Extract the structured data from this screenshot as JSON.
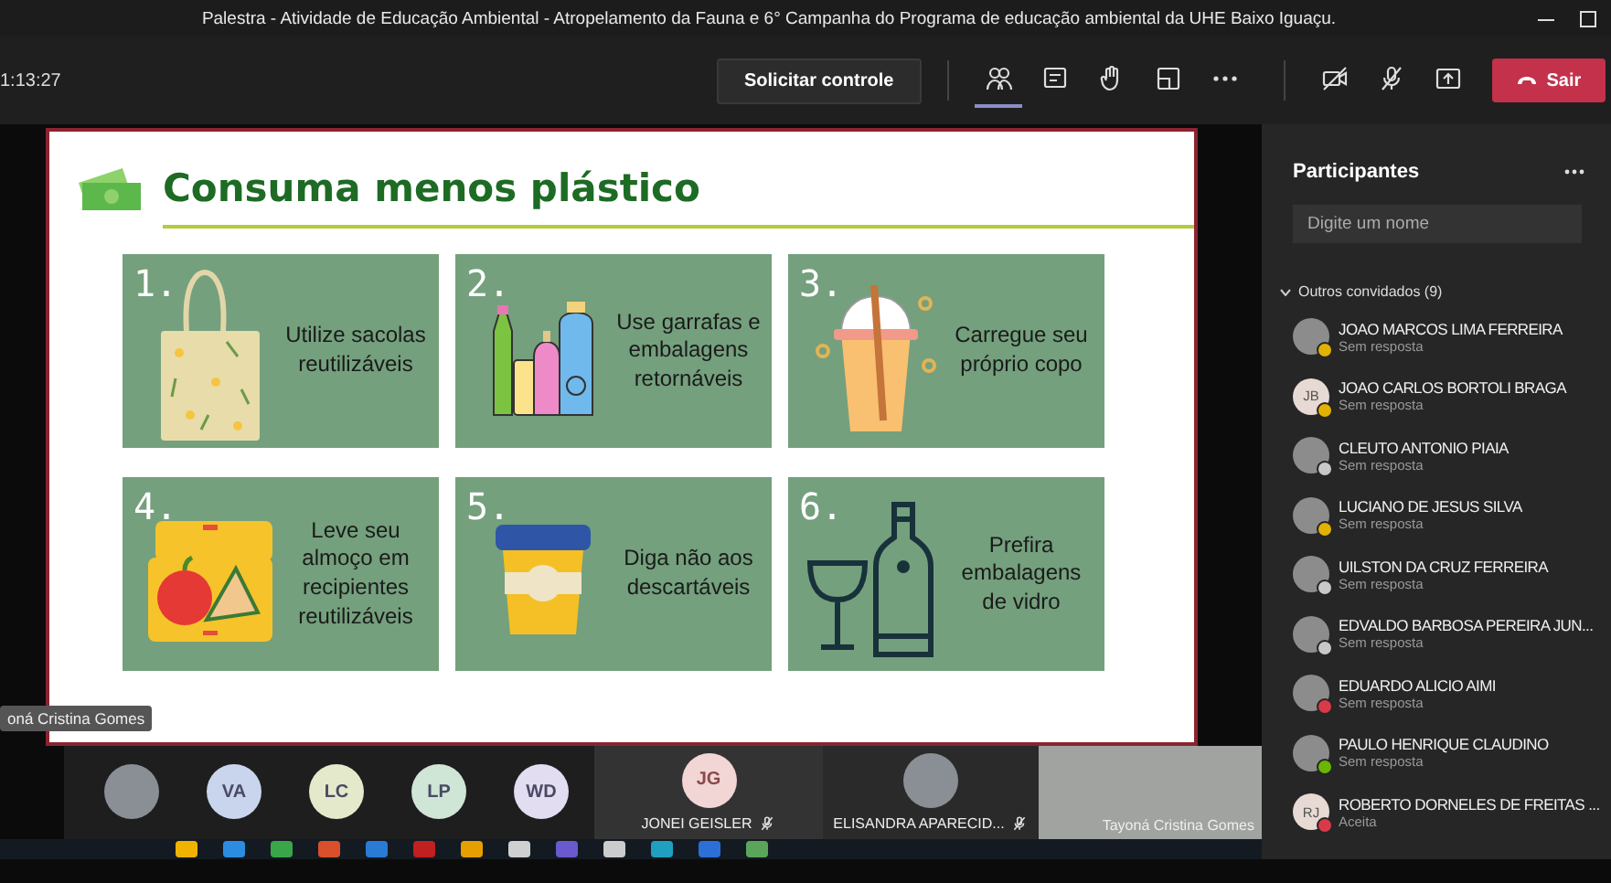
{
  "window": {
    "title": "Palestra - Atividade de Educação Ambiental - Atropelamento da Fauna e 6° Campanha do Programa de educação ambiental da UHE Baixo Iguaçu."
  },
  "toolbar": {
    "timer": "1:13:27",
    "request_control": "Solicitar controle",
    "tools": [
      {
        "kind": "people",
        "selected": true
      },
      {
        "kind": "chat",
        "selected": false
      },
      {
        "kind": "hand",
        "selected": false
      },
      {
        "kind": "rooms",
        "selected": false
      },
      {
        "kind": "more",
        "selected": false
      }
    ],
    "controls": [
      {
        "kind": "camera-off"
      },
      {
        "kind": "mic-off"
      },
      {
        "kind": "share"
      }
    ],
    "leave": "Sair"
  },
  "slide": {
    "title": "Consuma menos plástico",
    "cards": [
      {
        "number": "1.",
        "text": "Utilize sacolas reutilizáveis",
        "kind": "bag"
      },
      {
        "number": "2.",
        "text": "Use garrafas e embalagens retornáveis",
        "kind": "bottles"
      },
      {
        "number": "3.",
        "text": "Carregue seu próprio copo",
        "kind": "cup"
      },
      {
        "number": "4.",
        "text": "Leve seu almoço em recipientes reutilizáveis",
        "kind": "lunchbox"
      },
      {
        "number": "5.",
        "text": "Diga não aos descartáveis",
        "kind": "coffee"
      },
      {
        "number": "6.",
        "text": "Prefira embalagens de vidro",
        "kind": "glass"
      }
    ],
    "presenter_tag": "oná Cristina Gomes"
  },
  "gallery": {
    "avatars": [
      {
        "kind": "photo"
      },
      {
        "kind": "initials",
        "initials": "VA",
        "color": "#c8d5ec"
      },
      {
        "kind": "initials",
        "initials": "LC",
        "color": "#e4e9cb"
      },
      {
        "kind": "initials",
        "initials": "LP",
        "color": "#cfe5d6"
      },
      {
        "kind": "initials",
        "initials": "WD",
        "color": "#e2ddf0"
      }
    ],
    "tiles": [
      {
        "kind": "initials",
        "initials": "JG",
        "color": "#f2d5d5",
        "name": "JONEI GEISLER",
        "muted": true
      },
      {
        "kind": "photo",
        "name": "ELISANDRA APARECID...",
        "muted": true
      },
      {
        "kind": "video",
        "name": "Tayoná Cristina Gomes",
        "muted": false
      }
    ]
  },
  "participants": {
    "title": "Participantes",
    "search": {
      "placeholder": "Digite um nome"
    },
    "group": {
      "label": "Outros convidados (9)",
      "expanded": true
    },
    "people": [
      {
        "name": "JOAO MARCOS LIMA FERREIRA",
        "status": "Sem resposta",
        "kind": "photo",
        "color": "#e3b100"
      },
      {
        "name": "JOAO CARLOS BORTOLI BRAGA",
        "status": "Sem resposta",
        "kind": "initials",
        "initials": "JB",
        "color": "#e3b100"
      },
      {
        "name": "CLEUTO ANTONIO PIAIA",
        "status": "Sem resposta",
        "kind": "photo",
        "color": "#c8c8c8"
      },
      {
        "name": "LUCIANO DE JESUS SILVA",
        "status": "Sem resposta",
        "kind": "photo",
        "color": "#e3b100"
      },
      {
        "name": "UILSTON DA CRUZ FERREIRA",
        "status": "Sem resposta",
        "kind": "photo",
        "color": "#c8c8c8"
      },
      {
        "name": "EDVALDO BARBOSA PEREIRA JUN...",
        "status": "Sem resposta",
        "kind": "photo",
        "color": "#c8c8c8"
      },
      {
        "name": "EDUARDO ALICIO AIMI",
        "status": "Sem resposta",
        "kind": "photo",
        "color": "#d93a4a"
      },
      {
        "name": "PAULO HENRIQUE CLAUDINO",
        "status": "Sem resposta",
        "kind": "photo",
        "color": "#6bb700"
      },
      {
        "name": "ROBERTO DORNELES DE FREITAS ...",
        "status": "Aceita",
        "kind": "initials",
        "initials": "RJ",
        "color": "#d93a4a"
      }
    ]
  }
}
